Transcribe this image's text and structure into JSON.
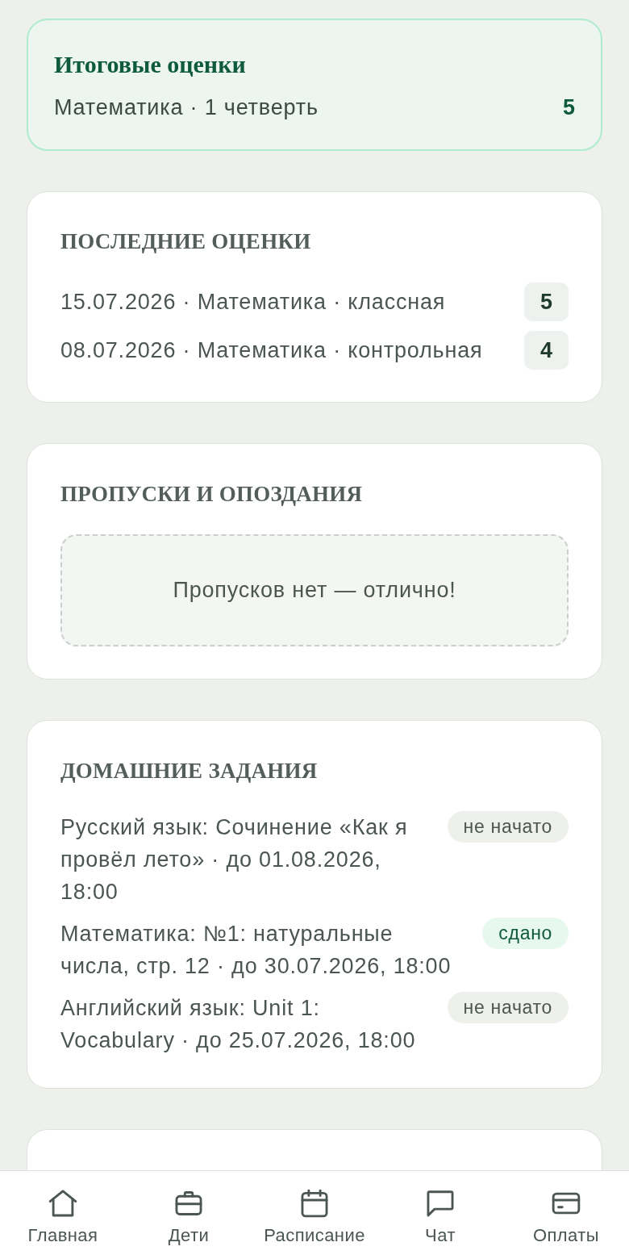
{
  "final_grades": {
    "title": "Итоговые оценки",
    "rows": [
      {
        "label": "Математика · 1 четверть",
        "grade": "5"
      }
    ]
  },
  "recent_grades": {
    "title": "ПОСЛЕДНИЕ ОЦЕНКИ",
    "rows": [
      {
        "text": "15.07.2026 · Математика · классная",
        "grade": "5"
      },
      {
        "text": "08.07.2026 · Математика · контрольная",
        "grade": "4"
      }
    ]
  },
  "absences": {
    "title": "ПРОПУСКИ И ОПОЗДАНИЯ",
    "empty_message": "Пропусков нет — отлично!"
  },
  "homework": {
    "title": "ДОМАШНИЕ ЗАДАНИЯ",
    "items": [
      {
        "text": "Русский язык: Сочинение «Как я провёл лето» · до 01.08.2026, 18:00",
        "status": "не начато",
        "kind": "pending"
      },
      {
        "text": "Математика: №1: натуральные числа, стр. 12 · до 30.07.2026, 18:00",
        "status": "сдано",
        "kind": "done"
      },
      {
        "text": "Английский язык: Unit 1: Vocabulary · до 25.07.2026, 18:00",
        "status": "не начато",
        "kind": "pending"
      }
    ]
  },
  "bottom_nav": {
    "items": [
      {
        "label": "Главная"
      },
      {
        "label": "Дети"
      },
      {
        "label": "Расписание"
      },
      {
        "label": "Чат"
      },
      {
        "label": "Оплаты"
      }
    ]
  }
}
